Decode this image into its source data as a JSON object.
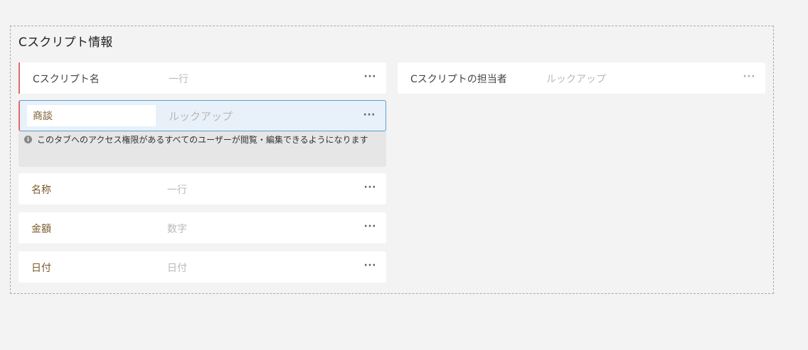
{
  "section": {
    "title": "Cスクリプト情報"
  },
  "fields": {
    "script_name": {
      "label": "Cスクリプト名",
      "type": "一行",
      "more": "···"
    },
    "owner": {
      "label": "Cスクリプトの担当者",
      "type": "ルックアップ",
      "more": "···"
    },
    "deal": {
      "label_value": "商談",
      "type": "ルックアップ",
      "more": "···",
      "hint": "このタブへのアクセス権限があるすべてのユーザーが閲覧・編集できるようになります"
    },
    "name": {
      "label": "名称",
      "type": "一行",
      "more": "···"
    },
    "amount": {
      "label": "金額",
      "type": "数字",
      "more": "···"
    },
    "date": {
      "label": "日付",
      "type": "日付",
      "more": "···"
    }
  },
  "icons": {
    "info": "info-icon"
  }
}
